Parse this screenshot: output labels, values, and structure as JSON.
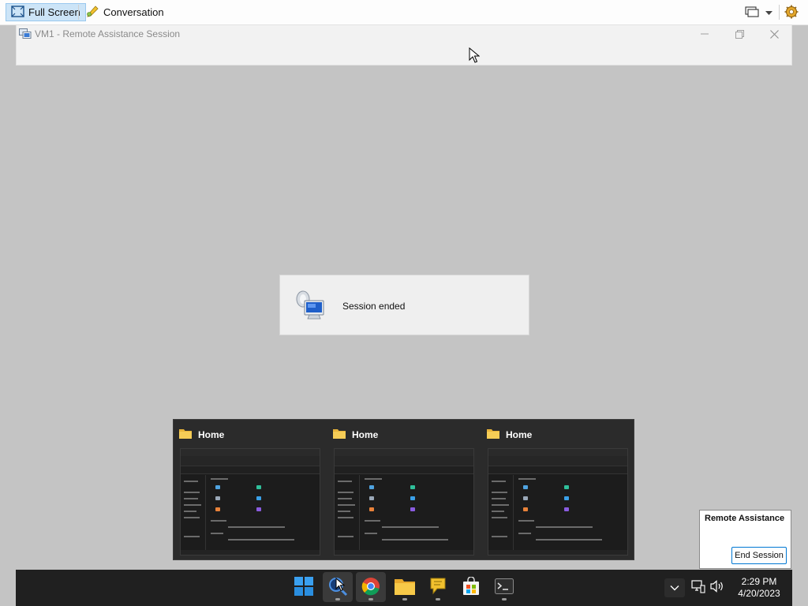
{
  "toolbar": {
    "fullscreen_label": "Full Screen",
    "conversation_label": "Conversation"
  },
  "session_window": {
    "title": "VM1 - Remote Assistance Session"
  },
  "dialog": {
    "message": "Session ended"
  },
  "thumbnails": [
    {
      "title": "Home"
    },
    {
      "title": "Home"
    },
    {
      "title": "Home"
    }
  ],
  "remote_assistance": {
    "title": "Remote Assistance",
    "end_session_label": "End Session"
  },
  "taskbar": {
    "apps": [
      "start-icon",
      "search-magnifier-icon",
      "chrome-icon",
      "file-explorer-icon",
      "chat-bubble-icon",
      "store-icon",
      "terminal-icon"
    ],
    "clock_time": "2:29 PM",
    "clock_date": "4/20/2023"
  },
  "colors": {
    "desktop_bg": "#c4c4c4",
    "taskbar_bg": "#202020",
    "accent": "#0078d4"
  }
}
